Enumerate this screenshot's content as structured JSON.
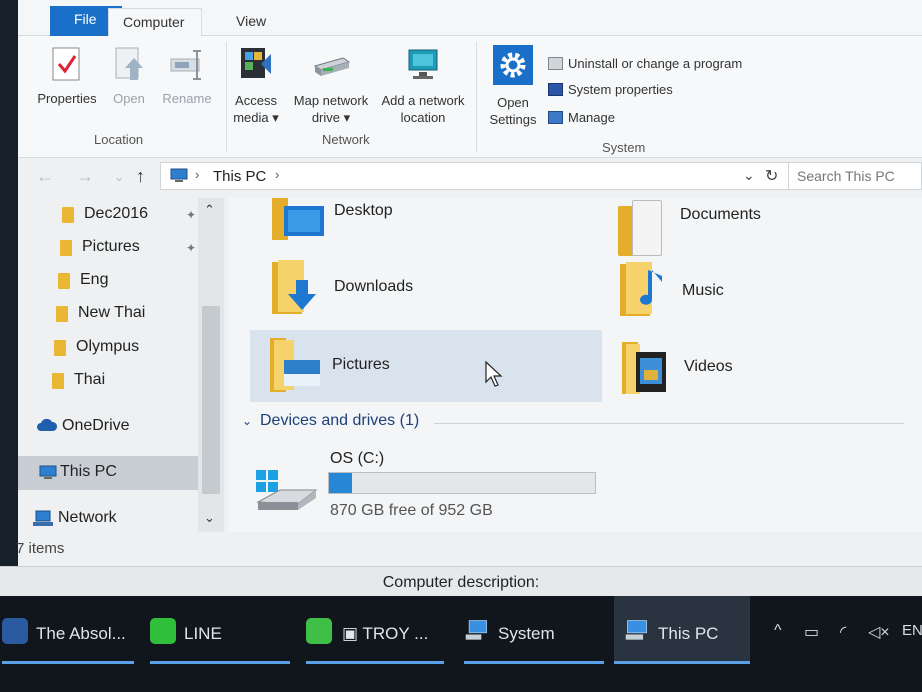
{
  "tabs": {
    "file": "File",
    "computer": "Computer",
    "view": "View"
  },
  "ribbon": {
    "location": {
      "group": "Location",
      "properties": "Properties",
      "open": "Open",
      "rename": "Rename"
    },
    "network": {
      "group": "Network",
      "access_media_1": "Access",
      "access_media_2": "media",
      "map_drive_1": "Map network",
      "map_drive_2": "drive",
      "add_location_1": "Add a network",
      "add_location_2": "location"
    },
    "system": {
      "group": "System",
      "open_settings_1": "Open",
      "open_settings_2": "Settings",
      "uninstall": "Uninstall or change a program",
      "system_properties": "System properties",
      "manage": "Manage"
    }
  },
  "address": {
    "path": "This PC",
    "search_placeholder": "Search This PC"
  },
  "nav": {
    "items": [
      "Dec2016",
      "Pictures",
      "Eng",
      "New Thai",
      "Olympus",
      "Thai",
      "OneDrive",
      "This PC",
      "Network"
    ]
  },
  "folders": [
    "Desktop",
    "Documents",
    "Downloads",
    "Music",
    "Pictures",
    "Videos"
  ],
  "drives": {
    "header": "Devices and drives (1)",
    "os": {
      "name": "OS (C:)",
      "free_text": "870 GB free of 952 GB",
      "used_fraction": 0.086
    }
  },
  "status": {
    "items": "7 items"
  },
  "description_label": "Computer description:",
  "taskbar": {
    "apps": [
      "The Absol...",
      "LINE",
      "TROY ...",
      "System",
      "This PC"
    ],
    "lang": "EN"
  },
  "colors": {
    "accent": "#1a6fc8",
    "selection": "#d9e3ee",
    "folder": "#f6d36a",
    "drive_fill": "#2687d6"
  }
}
